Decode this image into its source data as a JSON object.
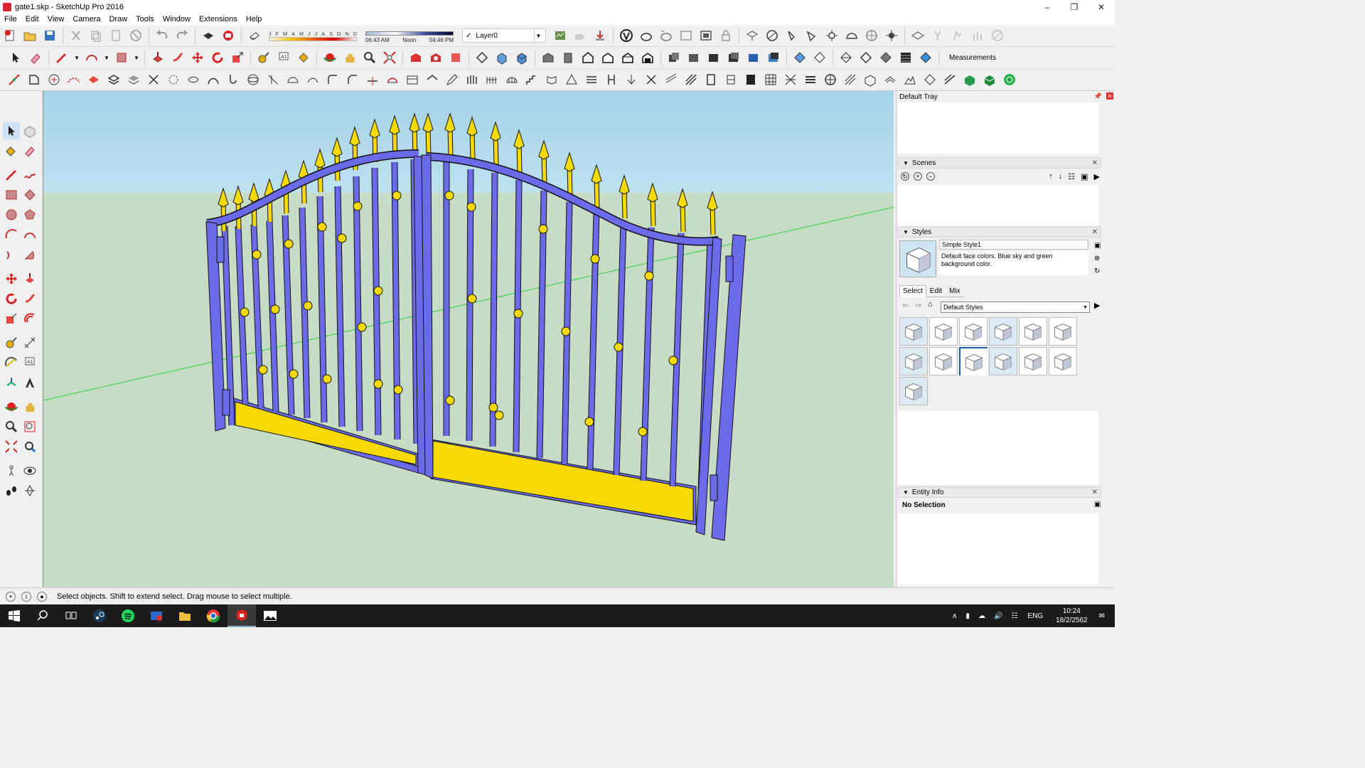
{
  "window": {
    "title": "gate1.skp - SketchUp Pro 2016",
    "controls": [
      "minimize-icon",
      "maximize-icon",
      "close-icon"
    ]
  },
  "menubar": {
    "items": [
      "File",
      "Edit",
      "View",
      "Camera",
      "Draw",
      "Tools",
      "Window",
      "Extensions",
      "Help"
    ]
  },
  "shadows": {
    "months": [
      "J",
      "F",
      "M",
      "A",
      "M",
      "J",
      "J",
      "A",
      "S",
      "O",
      "N",
      "D"
    ],
    "time_start": "06:43 AM",
    "time_mid": "Noon",
    "time_end": "04:46 PM"
  },
  "layers": {
    "current": "Layer0"
  },
  "measurements": {
    "label": "Measurements"
  },
  "statusbar": {
    "text": "Select objects. Shift to extend select. Drag mouse to select multiple."
  },
  "tray": {
    "title": "Default Tray",
    "scenes": {
      "title": "Scenes"
    },
    "styles": {
      "title": "Styles",
      "style_name": "Simple Style1",
      "style_description": "Default face colors. Blue sky and green background color.",
      "tabs": [
        "Select",
        "Edit",
        "Mix"
      ],
      "active_tab": "Select",
      "library": "Default Styles",
      "thumb_count": 13,
      "selected_thumb_index": 8
    },
    "entity_info": {
      "title": "Entity Info",
      "selection": "No Selection"
    }
  },
  "taskbar": {
    "clock_time": "10:24",
    "clock_date": "18/2/2562",
    "language": "ENG"
  },
  "colors": {
    "gate_frame": "#6b6bea",
    "gate_outline": "#111111",
    "gold": "#f5d900",
    "sky": "#bde1ef",
    "ground": "#c7dcc4",
    "axis_green": "#2ecc40"
  }
}
